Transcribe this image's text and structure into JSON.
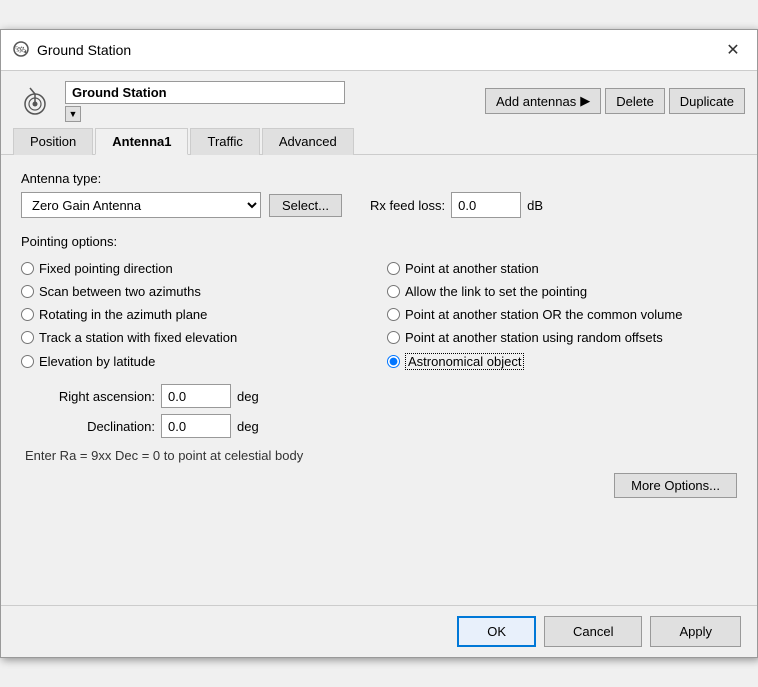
{
  "titleBar": {
    "title": "Ground Station",
    "closeLabel": "✕"
  },
  "header": {
    "nameValue": "Ground Station",
    "addAntennasLabel": "Add antennas",
    "arrowSymbol": "▶",
    "deleteLabel": "Delete",
    "duplicateLabel": "Duplicate",
    "dropdownArrow": "▼"
  },
  "tabs": [
    {
      "id": "position",
      "label": "Position",
      "active": false
    },
    {
      "id": "antenna1",
      "label": "Antenna1",
      "active": true
    },
    {
      "id": "traffic",
      "label": "Traffic",
      "active": false
    },
    {
      "id": "advanced",
      "label": "Advanced",
      "active": false
    }
  ],
  "antennaSection": {
    "typeLabel": "Antenna type:",
    "typeValue": "Zero Gain Antenna",
    "selectLabel": "Select...",
    "rxFeedLabel": "Rx feed loss:",
    "rxFeedValue": "0.0",
    "rxFeedUnit": "dB"
  },
  "pointingSection": {
    "label": "Pointing options:",
    "options": [
      {
        "id": "fixed",
        "label": "Fixed pointing direction",
        "side": "left",
        "checked": false
      },
      {
        "id": "point-station",
        "label": "Point at another station",
        "side": "right",
        "checked": false
      },
      {
        "id": "scan",
        "label": "Scan between two azimuths",
        "side": "left",
        "checked": false
      },
      {
        "id": "allow-link",
        "label": "Allow the link to set the pointing",
        "side": "right",
        "checked": false
      },
      {
        "id": "rotating",
        "label": "Rotating in the azimuth plane",
        "side": "left",
        "checked": false
      },
      {
        "id": "point-common",
        "label": "Point at another station OR the common volume",
        "side": "right",
        "checked": false
      },
      {
        "id": "track",
        "label": "Track a station with fixed elevation",
        "side": "left",
        "checked": false
      },
      {
        "id": "point-random",
        "label": "Point at another station using random offsets",
        "side": "right",
        "checked": false
      },
      {
        "id": "elevation",
        "label": "Elevation by latitude",
        "side": "left",
        "checked": false
      },
      {
        "id": "astronomical",
        "label": "Astronomical object",
        "side": "right",
        "checked": true,
        "dotted": true
      }
    ]
  },
  "params": {
    "rightAscensionLabel": "Right ascension:",
    "rightAscensionValue": "0.0",
    "rightAscensionUnit": "deg",
    "declinationLabel": "Declination:",
    "declinationValue": "0.0",
    "declinationUnit": "deg",
    "hintText": "Enter Ra = 9xx Dec = 0 to point at celestial body",
    "moreOptionsLabel": "More Options..."
  },
  "footer": {
    "okLabel": "OK",
    "cancelLabel": "Cancel",
    "applyLabel": "Apply"
  }
}
